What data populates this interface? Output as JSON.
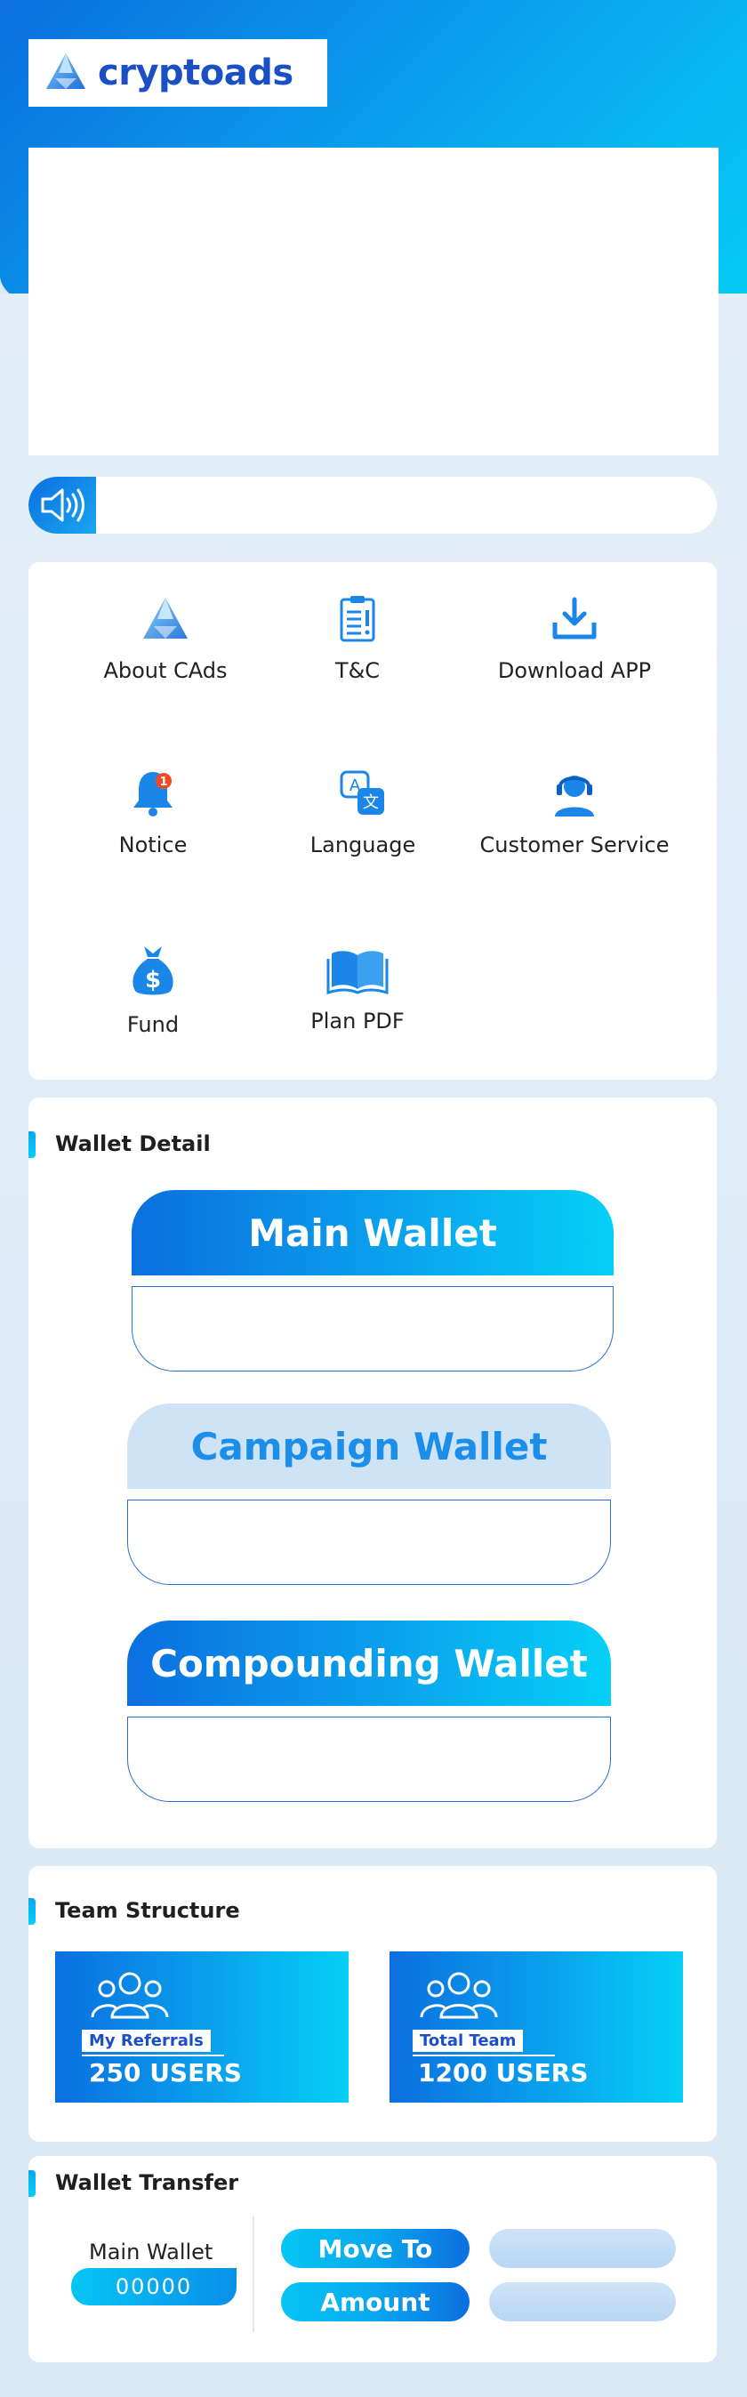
{
  "brand": {
    "name": "cryptoads"
  },
  "notice": {
    "icon": "speaker-icon",
    "text": ""
  },
  "menu": {
    "items": [
      {
        "label": "About CAds",
        "icon": "logo-pyramid-icon"
      },
      {
        "label": "T&C",
        "icon": "clipboard-icon"
      },
      {
        "label": "Download APP",
        "icon": "download-icon"
      },
      {
        "label": "Notice",
        "icon": "bell-icon",
        "badge": "1"
      },
      {
        "label": "Language",
        "icon": "translate-icon"
      },
      {
        "label": "Customer Service",
        "icon": "headset-agent-icon"
      },
      {
        "label": "Fund",
        "icon": "money-bag-icon"
      },
      {
        "label": "Plan PDF",
        "icon": "open-book-icon"
      }
    ]
  },
  "wallet_detail": {
    "title": "Wallet Detail",
    "wallets": [
      {
        "name": "Main Wallet",
        "value": ""
      },
      {
        "name": "Campaign Wallet",
        "value": ""
      },
      {
        "name": "Compounding Wallet",
        "value": ""
      }
    ]
  },
  "team": {
    "title": "Team Structure",
    "boxes": [
      {
        "tag": "My Referrals",
        "count": "250 USERS",
        "icon": "group-users-icon"
      },
      {
        "tag": "Total Team",
        "count": "1200 USERS",
        "icon": "group-users-icon"
      }
    ]
  },
  "transfer": {
    "title": "Wallet Transfer",
    "source_label": "Main Wallet",
    "source_value": "00000",
    "move_to_label": "Move To",
    "amount_label": "Amount",
    "move_to_value": "",
    "amount_value": ""
  },
  "colors": {
    "primary": "#0b6fe0",
    "accent": "#05d0f7",
    "light_blue": "#cfe3f7",
    "brand_text": "#1a4fc6"
  }
}
